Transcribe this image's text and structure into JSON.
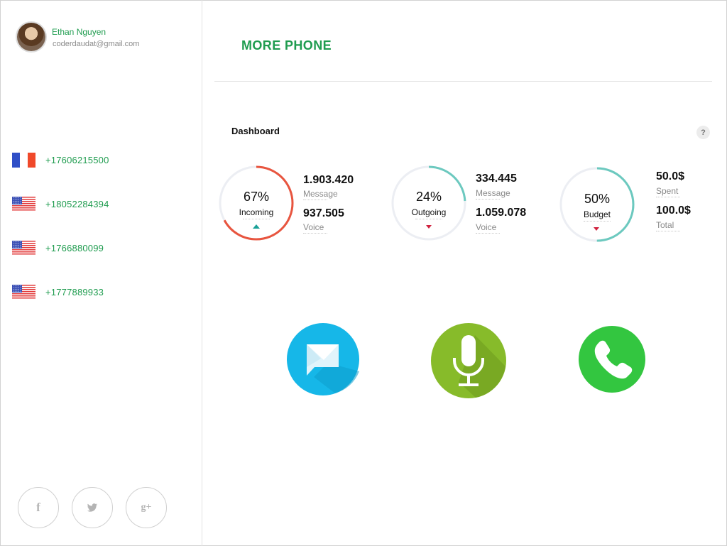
{
  "user": {
    "name": "Ethan Nguyen",
    "email": "coderdaudat@gmail.com"
  },
  "phones": [
    {
      "number": "+17606215500",
      "flag": "france-flag-icon"
    },
    {
      "number": "+18052284394",
      "flag": "usa-flag-icon"
    },
    {
      "number": "+1766880099",
      "flag": "usa-flag-icon"
    },
    {
      "number": "+1777889933",
      "flag": "usa-flag-icon"
    }
  ],
  "social": {
    "facebook": "f",
    "twitter": "twitter-icon",
    "googleplus": "g+"
  },
  "header": {
    "title": "MORE PHONE"
  },
  "dashboard": {
    "title": "Dashboard",
    "help": "?",
    "gauges": [
      {
        "percent_text": "67%",
        "percent": 67,
        "label": "Incoming",
        "color": "#e8553f",
        "trend": "up",
        "stats": [
          {
            "value": "1.903.420",
            "label": "Message"
          },
          {
            "value": "937.505",
            "label": "Voice"
          }
        ]
      },
      {
        "percent_text": "24%",
        "percent": 24,
        "label": "Outgoing",
        "color": "#6cc9bf",
        "trend": "down",
        "stats": [
          {
            "value": "334.445",
            "label": "Message"
          },
          {
            "value": "1.059.078",
            "label": "Voice"
          }
        ]
      },
      {
        "percent_text": "50%",
        "percent": 50,
        "label": "Budget",
        "color": "#6cc9bf",
        "trend": "down",
        "stats": [
          {
            "value": "50.0$",
            "label": "Spent"
          },
          {
            "value": "100.0$",
            "label": "Total"
          }
        ]
      }
    ]
  },
  "actions": [
    {
      "name": "message-button",
      "icon": "message-icon",
      "color": "#16b7e8"
    },
    {
      "name": "voice-button",
      "icon": "microphone-icon",
      "color": "#87bb2a"
    },
    {
      "name": "call-button",
      "icon": "phone-icon",
      "color": "#33c640"
    }
  ]
}
